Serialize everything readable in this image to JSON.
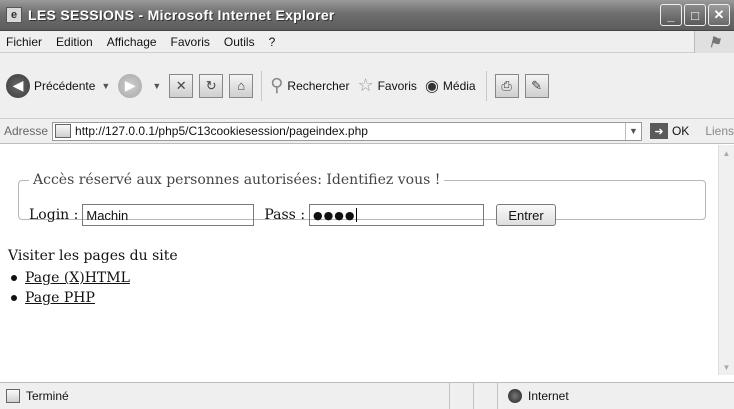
{
  "window": {
    "title": "LES SESSIONS - Microsoft Internet Explorer",
    "controls": [
      "_",
      "□",
      "✕"
    ]
  },
  "menubar": {
    "items": [
      "Fichier",
      "Edition",
      "Affichage",
      "Favoris",
      "Outils",
      "?"
    ]
  },
  "toolbar": {
    "back_label": "Précédente",
    "search_label": "Rechercher",
    "favorites_label": "Favoris",
    "media_label": "Média"
  },
  "addressbar": {
    "label": "Adresse",
    "url": "http://127.0.0.1/php5/C13cookiesession/pageindex.php",
    "go_label": "OK",
    "links_label": "Liens"
  },
  "form": {
    "legend": "Accès réservé aux personnes autorisées: Identifiez vous !",
    "login_label": "Login :",
    "login_value": "Machin",
    "pass_label": "Pass :",
    "pass_value": "●●●●",
    "submit_label": "Entrer"
  },
  "content": {
    "visit_text": "Visiter les pages du site",
    "links": [
      "Page (X)HTML",
      "Page PHP"
    ]
  },
  "statusbar": {
    "status_text": "Terminé",
    "zone_text": "Internet"
  }
}
